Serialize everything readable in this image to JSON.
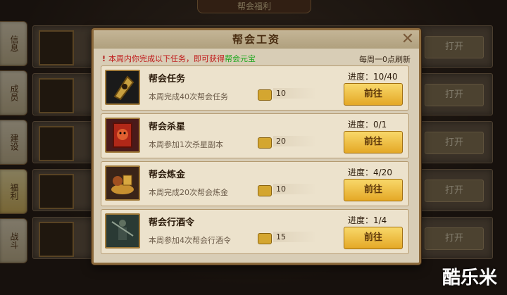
{
  "background": {
    "title": "帮会福利",
    "side_tabs": [
      "信息",
      "成员",
      "建设",
      "福利",
      "战斗"
    ],
    "active_tab": 3,
    "row_button": "打开"
  },
  "modal": {
    "title": "帮会工资",
    "notice_prefix": "本周内你完成以下任务，即可获得",
    "notice_highlight": "帮会元宝",
    "refresh": "每周一0点刷新",
    "go_label": "前往",
    "tasks": [
      {
        "name": "帮会任务",
        "desc": "本周完成40次帮会任务",
        "reward": "10",
        "progress": "进度：10/40",
        "icon": "medal-icon"
      },
      {
        "name": "帮会杀星",
        "desc": "本周参加1次杀星副本",
        "reward": "20",
        "progress": "进度：0/1",
        "icon": "demon-banner-icon"
      },
      {
        "name": "帮会炼金",
        "desc": "本周完成20次帮会炼金",
        "reward": "10",
        "progress": "进度：4/20",
        "icon": "gold-treasure-icon"
      },
      {
        "name": "帮会行酒令",
        "desc": "本周参加4次帮会行酒令",
        "reward": "15",
        "progress": "进度：1/4",
        "icon": "warrior-figure-icon"
      }
    ]
  },
  "watermark": "酷乐米"
}
